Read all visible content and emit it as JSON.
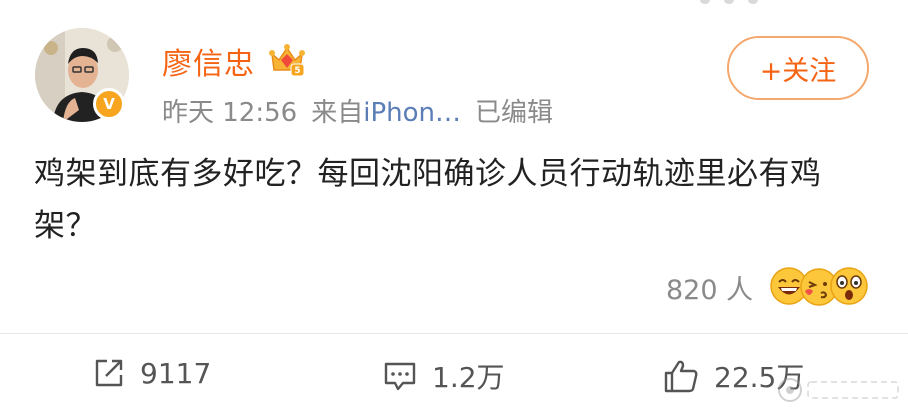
{
  "user": {
    "name": "廖信忠",
    "time": "昨天 12:56",
    "source_prefix": "来自",
    "source": "iPhon…",
    "edited": "已编辑",
    "verified_mark": "V"
  },
  "follow_button": {
    "label": "+关注"
  },
  "post": {
    "text": "鸡架到底有多好吃？每回沈阳确诊人员行动轨迹里必有鸡架？"
  },
  "reactions": {
    "count": "820 人"
  },
  "actions": {
    "repost": "9117",
    "comment": "1.2万",
    "like": "22.5万"
  },
  "colors": {
    "username": "#f56414",
    "source": "#5b7eb6",
    "badge": "#f7a51f",
    "meta": "#8a8a8a"
  }
}
